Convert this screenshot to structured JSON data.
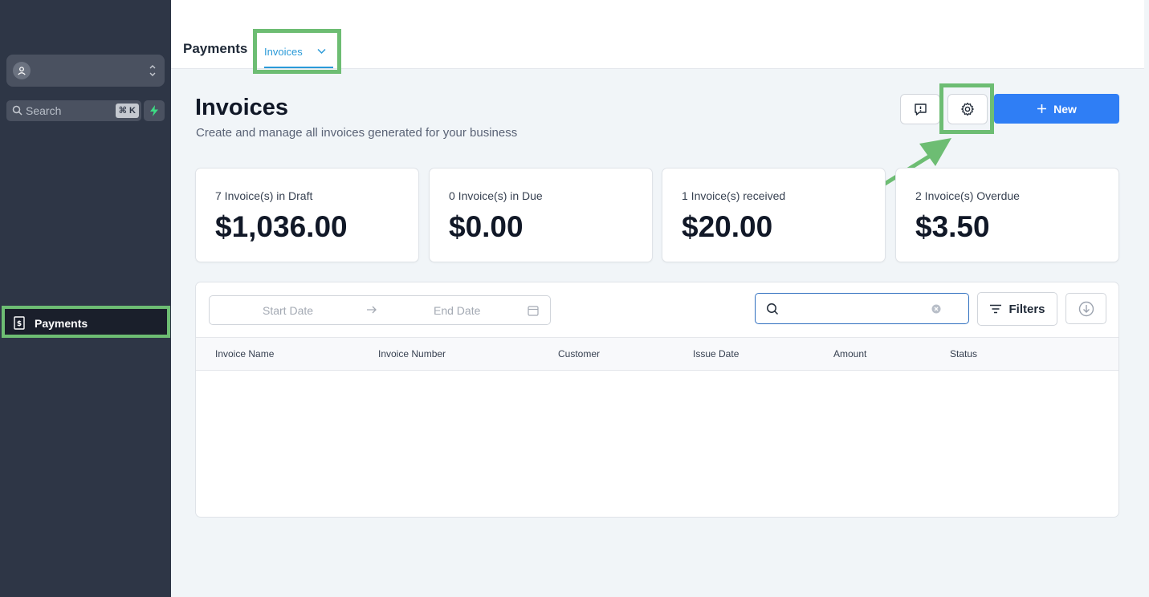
{
  "sidebar": {
    "search": {
      "label": "Search",
      "shortcut": "⌘ K"
    },
    "nav": [
      {
        "label": "Payments",
        "icon": "receipt-dollar-icon"
      }
    ]
  },
  "topbar": {
    "title": "Payments",
    "tab": {
      "label": "Invoices"
    }
  },
  "header": {
    "title": "Invoices",
    "subtitle": "Create and manage all invoices generated for your business",
    "new_button": "New"
  },
  "cards": [
    {
      "title": "7 Invoice(s) in Draft",
      "value": "$1,036.00"
    },
    {
      "title": "0 Invoice(s) in Due",
      "value": "$0.00"
    },
    {
      "title": "1 Invoice(s) received",
      "value": "$20.00"
    },
    {
      "title": "2 Invoice(s) Overdue",
      "value": "$3.50"
    }
  ],
  "table": {
    "date_start_placeholder": "Start Date",
    "date_end_placeholder": "End Date",
    "search_value": "",
    "filters_label": "Filters",
    "columns": [
      "Invoice Name",
      "Invoice Number",
      "Customer",
      "Issue Date",
      "Amount",
      "Status"
    ]
  },
  "colors": {
    "sidebar_bg": "#2e3646",
    "accent": "#2f7ef5",
    "tab_accent": "#2a9ad8",
    "highlight": "#6dbd73"
  }
}
